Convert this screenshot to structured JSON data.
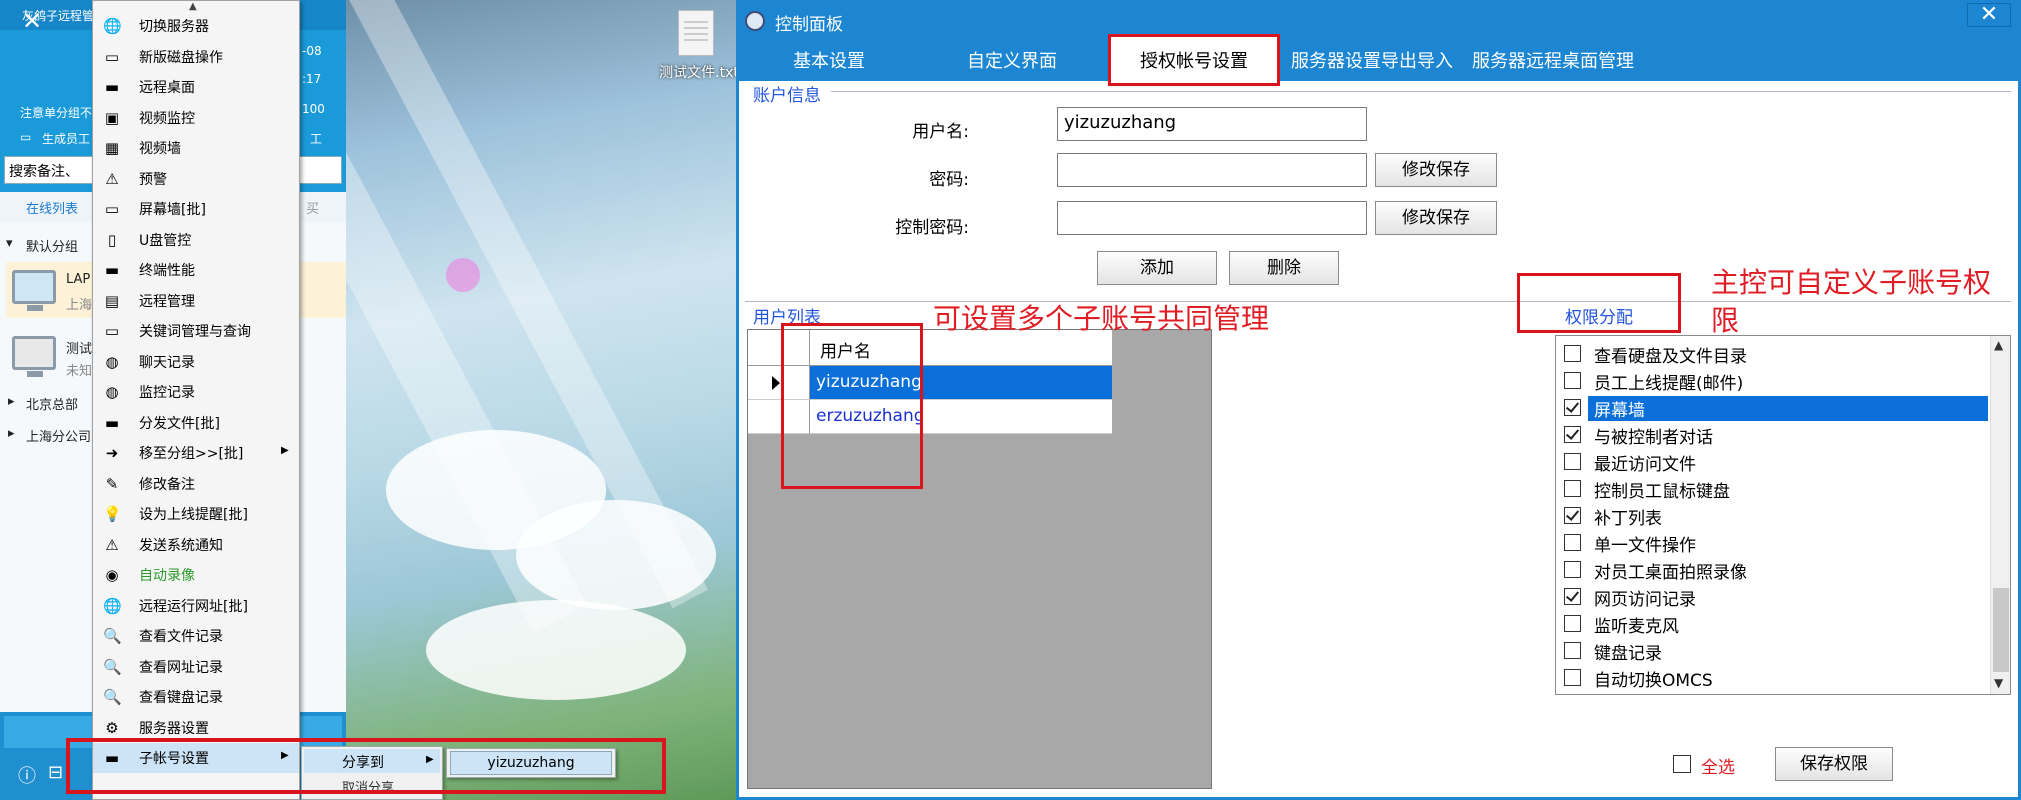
{
  "left_app": {
    "title": "灰鸽子远程管",
    "notice": "注意单分组不",
    "gen_staff": "生成员工",
    "right_date": "-08",
    "right_time": ":17",
    "right_num": "100",
    "right_staff": "工",
    "search_placeholder": "搜索备注、",
    "tab_online": "在线列表",
    "tab_buy": "买",
    "default_group": "默认分组",
    "device1_name": "LAP",
    "device1_loc": "上海",
    "device2_name": "测试",
    "device2_status": "未知",
    "group_beijing": "北京总部",
    "group_shanghai": "上海分公司"
  },
  "desktop": {
    "file_label": "测试文件.txt"
  },
  "context_menu": {
    "items": [
      {
        "label": "切换服务器",
        "icon": "globe-icon",
        "glyph": "🌐"
      },
      {
        "label": "新版磁盘操作",
        "icon": "disk-icon",
        "glyph": "▭"
      },
      {
        "label": "远程桌面",
        "icon": "desktop-icon",
        "glyph": "▬"
      },
      {
        "label": "视频监控",
        "icon": "camera-icon",
        "glyph": "▣"
      },
      {
        "label": "视频墙",
        "icon": "video-wall-icon",
        "glyph": "▦"
      },
      {
        "label": "预警",
        "icon": "warning-icon",
        "glyph": "⚠"
      },
      {
        "label": "屏幕墙[批]",
        "icon": "screen-wall-icon",
        "glyph": "▭"
      },
      {
        "label": "U盘管控",
        "icon": "usb-icon",
        "glyph": "▯"
      },
      {
        "label": "终端性能",
        "icon": "terminal-icon",
        "glyph": "▬"
      },
      {
        "label": "远程管理",
        "icon": "manage-icon",
        "glyph": "▤"
      },
      {
        "label": "关键词管理与查询",
        "icon": "keyword-icon",
        "glyph": "▭"
      },
      {
        "label": "聊天记录",
        "icon": "chat-icon",
        "glyph": "◍"
      },
      {
        "label": "监控记录",
        "icon": "monitor-log-icon",
        "glyph": "◍"
      },
      {
        "label": "分发文件[批]",
        "icon": "folder-icon",
        "glyph": "▬"
      },
      {
        "label": "移至分组>>[批]",
        "icon": "move-icon",
        "glyph": "➜"
      },
      {
        "label": "修改备注",
        "icon": "edit-icon",
        "glyph": "✎"
      },
      {
        "label": "设为上线提醒[批]",
        "icon": "bulb-icon",
        "glyph": "💡"
      },
      {
        "label": "发送系统通知",
        "icon": "alert-icon",
        "glyph": "⚠"
      },
      {
        "label": "自动录像",
        "icon": "record-icon",
        "glyph": "◉"
      },
      {
        "label": "远程运行网址[批]",
        "icon": "web-icon",
        "glyph": "🌐"
      },
      {
        "label": "查看文件记录",
        "icon": "search-icon",
        "glyph": "🔍"
      },
      {
        "label": "查看网址记录",
        "icon": "search-icon",
        "glyph": "🔍"
      },
      {
        "label": "查看键盘记录",
        "icon": "search-icon",
        "glyph": "🔍"
      },
      {
        "label": "服务器设置",
        "icon": "gear-icon",
        "glyph": "⚙"
      },
      {
        "label": "子帐号设置",
        "icon": "subaccount-icon",
        "glyph": "▬"
      }
    ],
    "share_to": "分享到",
    "cancel_share": "取消分享",
    "share_user": "yizuzuzhang"
  },
  "panel": {
    "title": "控制面板",
    "close": "✕",
    "tabs": {
      "basic": "基本设置",
      "custom_ui": "自定义界面",
      "auth": "授权帐号设置",
      "export_import": "服务器设置导出导入",
      "remote_desktop": "服务器远程桌面管理"
    },
    "account_info": "账户信息",
    "username_label": "用户名:",
    "username_value": "yizuzuzhang",
    "password_label": "密码:",
    "control_pwd_label": "控制密码:",
    "save_btn1": "修改保存",
    "save_btn2": "修改保存",
    "add_btn": "添加",
    "delete_btn": "删除",
    "user_list": "用户列表",
    "grid_header": "用户名",
    "users": [
      "yizuzuzhang",
      "erzuzuzhang"
    ],
    "annotation_multi": "可设置多个子账号共同管理",
    "annotation_custom_line1": "主控可自定义子账号权",
    "annotation_custom_line2": "限",
    "perm_title": "权限分配",
    "permissions": [
      {
        "label": "查看硬盘及文件目录",
        "checked": false
      },
      {
        "label": "员工上线提醒(邮件)",
        "checked": false
      },
      {
        "label": "屏幕墙",
        "checked": true
      },
      {
        "label": "与被控制者对话",
        "checked": true
      },
      {
        "label": "最近访问文件",
        "checked": false
      },
      {
        "label": "控制员工鼠标键盘",
        "checked": false
      },
      {
        "label": "补丁列表",
        "checked": true
      },
      {
        "label": "单一文件操作",
        "checked": false
      },
      {
        "label": "对员工桌面拍照录像",
        "checked": false
      },
      {
        "label": "网页访问记录",
        "checked": true
      },
      {
        "label": "监听麦克风",
        "checked": false
      },
      {
        "label": "键盘记录",
        "checked": false
      },
      {
        "label": "自动切换OMCS",
        "checked": false
      }
    ],
    "select_all": "全选",
    "save_perm": "保存权限"
  }
}
